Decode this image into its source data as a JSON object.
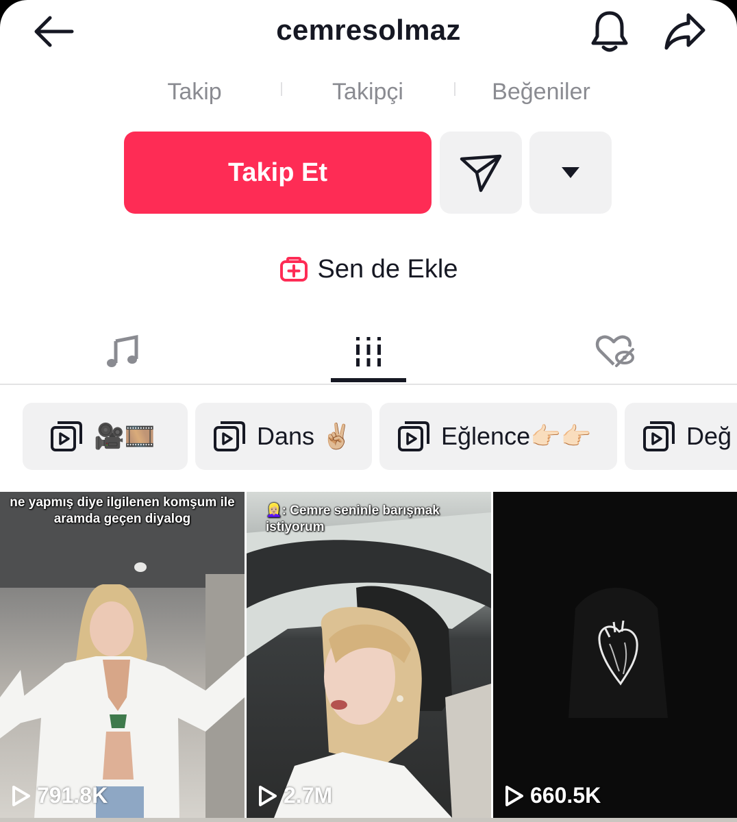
{
  "header": {
    "username": "cemresolmaz"
  },
  "stats": {
    "following_label": "Takip",
    "followers_label": "Takipçi",
    "likes_label": "Beğeniler"
  },
  "actions": {
    "follow_label": "Takip Et",
    "add_yours_label": "Sen de Ekle"
  },
  "tabs": [
    {
      "name": "music",
      "icon": "music-note-icon",
      "active": false
    },
    {
      "name": "videos",
      "icon": "grid-icon",
      "active": true
    },
    {
      "name": "liked",
      "icon": "liked-hidden-icon",
      "active": false
    }
  ],
  "playlists": [
    {
      "label": "🎥🎞️"
    },
    {
      "label": "Dans ✌🏼"
    },
    {
      "label": "Eğlence👉🏻👉🏻"
    },
    {
      "label": "Değ"
    }
  ],
  "videos": [
    {
      "caption": "ne yapmış diye ilgilenen komşum ile aramda geçen diyalog",
      "views": "791.8K"
    },
    {
      "caption": "👱🏼‍♀️: Cemre seninle barışmak istiyorum",
      "views": "2.7M"
    },
    {
      "caption": "",
      "views": "660.5K"
    }
  ],
  "colors": {
    "accent": "#fe2c55",
    "button_bg": "#f1f1f2",
    "muted_text": "#8a8b91"
  }
}
